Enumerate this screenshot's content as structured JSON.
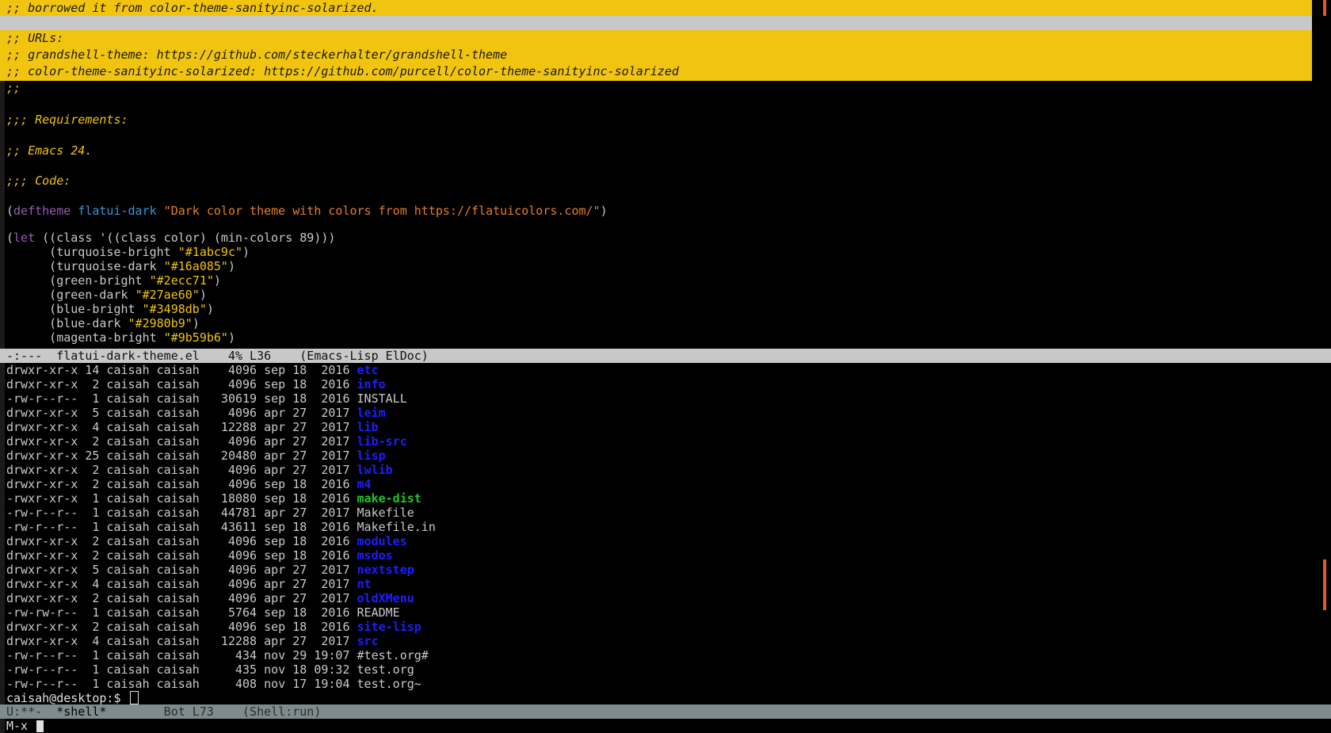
{
  "editor": {
    "header_comment_1": ";; borrowed it from color-theme-sanityinc-solarized.",
    "urls_comment": ";; URLs:",
    "url_grandshell": ";; grandshell-theme: https://github.com/steckerhalter/grandshell-theme",
    "url_sanityinc": ";; color-theme-sanityinc-solarized: https://github.com/purcell/color-theme-sanityinc-solarized",
    "empty_comment": ";;",
    "requirements": ";;; Requirements:",
    "emacs_version": ";; Emacs 24.",
    "code_header": ";;; Code:",
    "deftheme_open": "(",
    "deftheme_kw": "deftheme",
    "deftheme_name": "flatui-dark",
    "deftheme_doc": "\"Dark color theme with colors from https://flatuicolors.com/\"",
    "deftheme_close": ")",
    "let_open": "(",
    "let_kw": "let",
    "let_rest": " ((class '((class color) (min-colors 89)))",
    "color_defs": [
      {
        "name": "turquoise-bright",
        "value": "\"#1abc9c\""
      },
      {
        "name": "turquoise-dark",
        "value": "\"#16a085\""
      },
      {
        "name": "green-bright",
        "value": "\"#2ecc71\""
      },
      {
        "name": "green-dark",
        "value": "\"#27ae60\""
      },
      {
        "name": "blue-bright",
        "value": "\"#3498db\""
      },
      {
        "name": "blue-dark",
        "value": "\"#2980b9\""
      },
      {
        "name": "magenta-bright",
        "value": "\"#9b59b6\""
      }
    ]
  },
  "modeline_top": "-:---  flatui-dark-theme.el    4% L36    (Emacs-Lisp ElDoc)",
  "shell": {
    "listing": [
      {
        "meta": "drwxr-xr-x 14 caisah caisah    4096 sep 18  2016 ",
        "name": "etc",
        "type": "dir"
      },
      {
        "meta": "drwxr-xr-x  2 caisah caisah    4096 sep 18  2016 ",
        "name": "info",
        "type": "dir"
      },
      {
        "meta": "-rw-r--r--  1 caisah caisah   30619 sep 18  2016 ",
        "name": "INSTALL",
        "type": "file"
      },
      {
        "meta": "drwxr-xr-x  5 caisah caisah    4096 apr 27  2017 ",
        "name": "leim",
        "type": "dir"
      },
      {
        "meta": "drwxr-xr-x  4 caisah caisah   12288 apr 27  2017 ",
        "name": "lib",
        "type": "dir"
      },
      {
        "meta": "drwxr-xr-x  2 caisah caisah    4096 apr 27  2017 ",
        "name": "lib-src",
        "type": "dir"
      },
      {
        "meta": "drwxr-xr-x 25 caisah caisah   20480 apr 27  2017 ",
        "name": "lisp",
        "type": "dir"
      },
      {
        "meta": "drwxr-xr-x  2 caisah caisah    4096 apr 27  2017 ",
        "name": "lwlib",
        "type": "dir"
      },
      {
        "meta": "drwxr-xr-x  2 caisah caisah    4096 sep 18  2016 ",
        "name": "m4",
        "type": "dir"
      },
      {
        "meta": "-rwxr-xr-x  1 caisah caisah   18080 sep 18  2016 ",
        "name": "make-dist",
        "type": "exe"
      },
      {
        "meta": "-rw-r--r--  1 caisah caisah   44781 apr 27  2017 ",
        "name": "Makefile",
        "type": "file"
      },
      {
        "meta": "-rw-r--r--  1 caisah caisah   43611 sep 18  2016 ",
        "name": "Makefile.in",
        "type": "file"
      },
      {
        "meta": "drwxr-xr-x  2 caisah caisah    4096 sep 18  2016 ",
        "name": "modules",
        "type": "dir"
      },
      {
        "meta": "drwxr-xr-x  2 caisah caisah    4096 sep 18  2016 ",
        "name": "msdos",
        "type": "dir"
      },
      {
        "meta": "drwxr-xr-x  5 caisah caisah    4096 apr 27  2017 ",
        "name": "nextstep",
        "type": "dir"
      },
      {
        "meta": "drwxr-xr-x  4 caisah caisah    4096 apr 27  2017 ",
        "name": "nt",
        "type": "dir"
      },
      {
        "meta": "drwxr-xr-x  2 caisah caisah    4096 apr 27  2017 ",
        "name": "oldXMenu",
        "type": "dir"
      },
      {
        "meta": "-rw-rw-r--  1 caisah caisah    5764 sep 18  2016 ",
        "name": "README",
        "type": "file"
      },
      {
        "meta": "drwxr-xr-x  2 caisah caisah    4096 sep 18  2016 ",
        "name": "site-lisp",
        "type": "dir"
      },
      {
        "meta": "drwxr-xr-x  4 caisah caisah   12288 apr 27  2017 ",
        "name": "src",
        "type": "dir"
      },
      {
        "meta": "-rw-r--r--  1 caisah caisah     434 nov 29 19:07 ",
        "name": "#test.org#",
        "type": "file"
      },
      {
        "meta": "-rw-r--r--  1 caisah caisah     435 nov 18 09:32 ",
        "name": "test.org",
        "type": "file"
      },
      {
        "meta": "-rw-r--r--  1 caisah caisah     408 nov 17 19:04 ",
        "name": "test.org~",
        "type": "file"
      }
    ],
    "prompt": "caisah@desktop:$ "
  },
  "modeline_bottom_prefix": "U:**-  ",
  "modeline_bottom_buffer": "*shell*",
  "modeline_bottom_rest": "        Bot L73    (Shell:run)",
  "minibuffer": "M-x "
}
